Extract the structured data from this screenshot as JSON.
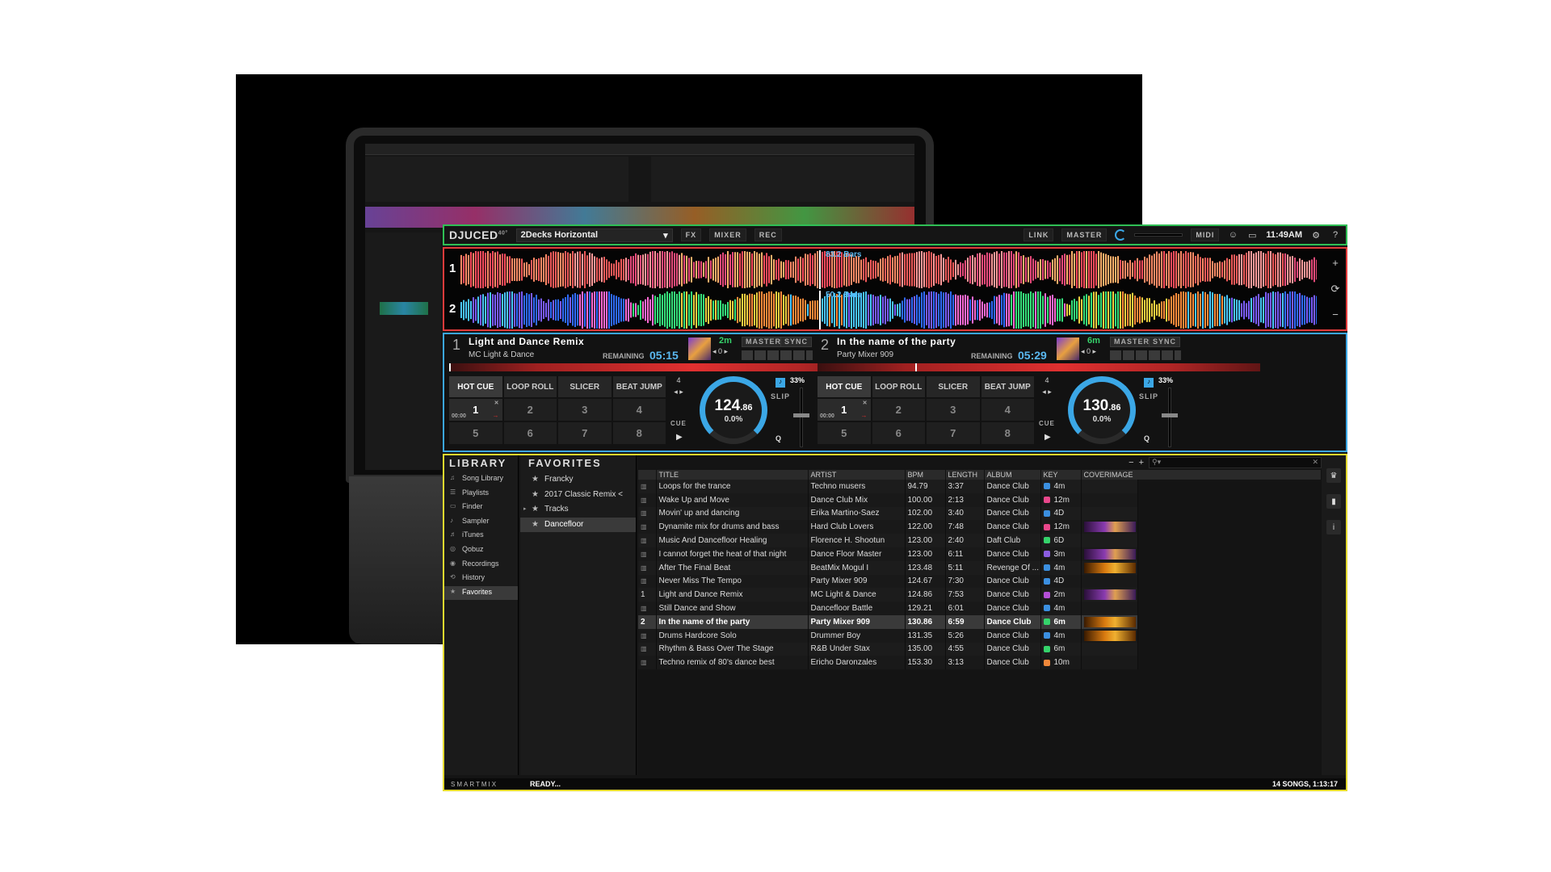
{
  "topbar": {
    "logo": "DJUCED",
    "logo_sup": "40°",
    "layout": "2Decks Horizontal",
    "fx": "FX",
    "mixer": "MIXER",
    "rec": "REC",
    "link": "LINK",
    "master": "MASTER",
    "midi": "MIDI",
    "clock": "11:49AM",
    "help": "?"
  },
  "waveforms": {
    "deck1": {
      "num": "1",
      "bars": "83.2 Bars"
    },
    "deck2": {
      "num": "2",
      "bars": "50.2 Bars"
    }
  },
  "decks": [
    {
      "num": "1",
      "title": "Light and Dance Remix",
      "artist": "MC Light & Dance",
      "remaining_label": "REMAINING",
      "remaining": "05:15",
      "key": "2m",
      "pitch_offset": "0",
      "master": "MASTER",
      "sync": "SYNC",
      "progress": 0.0,
      "tabs": [
        "HOT CUE",
        "LOOP ROLL",
        "SLICER",
        "BEAT JUMP"
      ],
      "pads": [
        "1",
        "2",
        "3",
        "4",
        "5",
        "6",
        "7",
        "8"
      ],
      "pad1_time": "00:00",
      "beats": "4",
      "cue": "CUE",
      "bpm": "124",
      "bpm_dec": ".86",
      "pitch": "0.0%",
      "percent": "33%",
      "slip": "SLIP",
      "q": "Q"
    },
    {
      "num": "2",
      "title": "In the name of the party",
      "artist": "Party Mixer 909",
      "remaining_label": "REMAINING",
      "remaining": "05:29",
      "key": "6m",
      "pitch_offset": "0",
      "master": "MASTER",
      "sync": "SYNC",
      "progress": 0.22,
      "tabs": [
        "HOT CUE",
        "LOOP ROLL",
        "SLICER",
        "BEAT JUMP"
      ],
      "pads": [
        "1",
        "2",
        "3",
        "4",
        "5",
        "6",
        "7",
        "8"
      ],
      "pad1_time": "00:00",
      "beats": "4",
      "cue": "CUE",
      "bpm": "130",
      "bpm_dec": ".86",
      "pitch": "0.0%",
      "percent": "33%",
      "slip": "SLIP",
      "q": "Q"
    }
  ],
  "library": {
    "heading": "LIBRARY",
    "items": [
      "Song Library",
      "Playlists",
      "Finder",
      "Sampler",
      "iTunes",
      "Qobuz",
      "Recordings",
      "History",
      "Favorites"
    ],
    "active_index": 8
  },
  "favorites": {
    "heading": "FAVORITES",
    "items": [
      "Francky",
      "2017 Classic Remix <",
      "Tracks",
      "Dancefloor"
    ],
    "active_index": 3
  },
  "tracks": {
    "columns": [
      "TITLE",
      "ARTIST",
      "BPM",
      "LENGTH",
      "ALBUM",
      "KEY",
      "COVERIMAGE"
    ],
    "rows": [
      {
        "deck": "",
        "title": "Loops for the trance",
        "artist": "Techno musers",
        "bpm": "94.79",
        "length": "3:37",
        "album": "Dance Club",
        "key": "4m",
        "key_color": "#3b8fe0",
        "cover": ""
      },
      {
        "deck": "",
        "title": "Wake Up and Move",
        "artist": "Dance Club Mix",
        "bpm": "100.00",
        "length": "2:13",
        "album": "Dance Club",
        "key": "12m",
        "key_color": "#e8478b",
        "cover": ""
      },
      {
        "deck": "",
        "title": "Movin' up and dancing",
        "artist": "Erika Martino-Saez",
        "bpm": "102.00",
        "length": "3:40",
        "album": "Dance Club",
        "key": "4D",
        "key_color": "#3b8fe0",
        "cover": ""
      },
      {
        "deck": "",
        "title": "Dynamite mix for drums and bass",
        "artist": "Hard Club Lovers",
        "bpm": "122.00",
        "length": "7:48",
        "album": "Dance Club",
        "key": "12m",
        "key_color": "#e8478b",
        "cover": "purple"
      },
      {
        "deck": "",
        "title": "Music And Dancefloor Healing",
        "artist": "Florence H. Shootun",
        "bpm": "123.00",
        "length": "2:40",
        "album": "Daft Club",
        "key": "6D",
        "key_color": "#35d36b",
        "cover": ""
      },
      {
        "deck": "",
        "title": "I cannot forget the heat of that night",
        "artist": "Dance Floor Master",
        "bpm": "123.00",
        "length": "6:11",
        "album": "Dance Club",
        "key": "3m",
        "key_color": "#8a5ce0",
        "cover": "purple"
      },
      {
        "deck": "",
        "title": "After The Final Beat",
        "artist": "BeatMix Mogul I",
        "bpm": "123.48",
        "length": "5:11",
        "album": "Revenge Of ...",
        "key": "4m",
        "key_color": "#3b8fe0",
        "cover": "orange"
      },
      {
        "deck": "",
        "title": "Never Miss The Tempo",
        "artist": "Party Mixer 909",
        "bpm": "124.67",
        "length": "7:30",
        "album": "Dance Club",
        "key": "4D",
        "key_color": "#3b8fe0",
        "cover": ""
      },
      {
        "deck": "1",
        "title": "Light and Dance Remix",
        "artist": "MC Light & Dance",
        "bpm": "124.86",
        "length": "7:53",
        "album": "Dance Club",
        "key": "2m",
        "key_color": "#b44fd6",
        "cover": "purple"
      },
      {
        "deck": "",
        "title": "Still Dance and Show",
        "artist": "Dancefloor Battle",
        "bpm": "129.21",
        "length": "6:01",
        "album": "Dance Club",
        "key": "4m",
        "key_color": "#3b8fe0",
        "cover": ""
      },
      {
        "deck": "2",
        "title": "In the name of the party",
        "artist": "Party Mixer 909",
        "bpm": "130.86",
        "length": "6:59",
        "album": "Dance Club",
        "key": "6m",
        "key_color": "#35d36b",
        "cover": "orange"
      },
      {
        "deck": "",
        "title": "Drums Hardcore Solo",
        "artist": "Drummer Boy",
        "bpm": "131.35",
        "length": "5:26",
        "album": "Dance Club",
        "key": "4m",
        "key_color": "#3b8fe0",
        "cover": "orange"
      },
      {
        "deck": "",
        "title": "Rhythm & Bass Over The Stage",
        "artist": "R&B Under Stax",
        "bpm": "135.00",
        "length": "4:55",
        "album": "Dance Club",
        "key": "6m",
        "key_color": "#35d36b",
        "cover": ""
      },
      {
        "deck": "",
        "title": "Techno remix of 80's dance best",
        "artist": "Ericho Daronzales",
        "bpm": "153.30",
        "length": "3:13",
        "album": "Dance Club",
        "key": "10m",
        "key_color": "#f0883a",
        "cover": ""
      }
    ],
    "loaded_index": 10
  },
  "footer": {
    "smartmix": "SMARTMIX",
    "status": "READY...",
    "count": "14 SONGS, 1:13:17"
  },
  "colors": {
    "accent": "#3ba7e6",
    "frame_topbar": "#2fbf55",
    "frame_waves": "#e23b3b",
    "frame_decks": "#3ba7e6",
    "frame_library": "#e3d92e"
  }
}
